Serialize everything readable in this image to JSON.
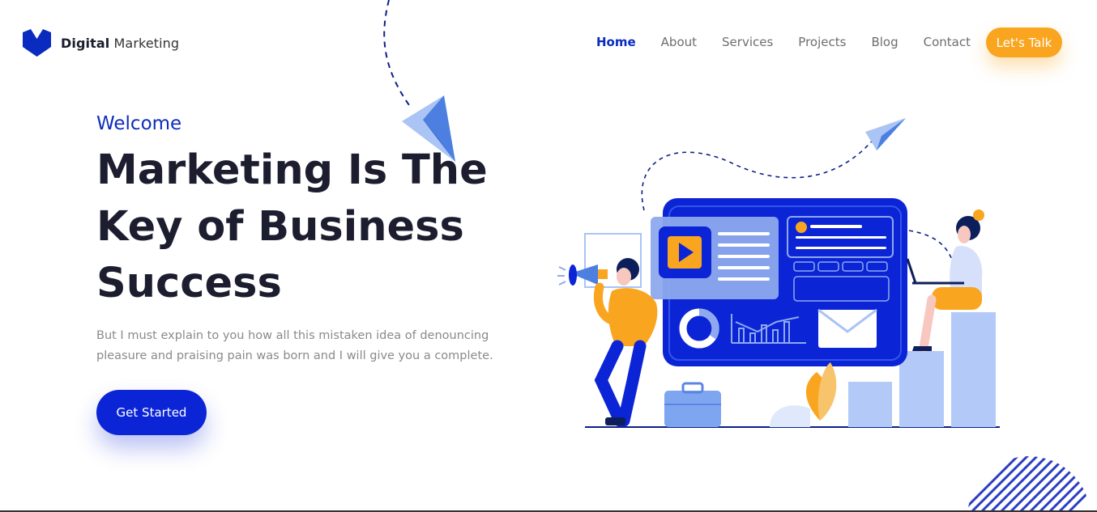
{
  "brand": {
    "name_bold": "Digital",
    "name_light": "Marketing",
    "icon": "logo-mark-icon",
    "color": "#0a2bbf"
  },
  "nav": {
    "items": [
      {
        "label": "Home",
        "active": true
      },
      {
        "label": "About"
      },
      {
        "label": "Services"
      },
      {
        "label": "Projects"
      },
      {
        "label": "Blog"
      },
      {
        "label": "Contact"
      }
    ],
    "cta_label": "Let's Talk"
  },
  "hero": {
    "welcome": "Welcome",
    "headline": "Marketing Is The Key of Business Success",
    "paragraph": "But I must explain to you how all this mistaken idea of denouncing pleasure and praising pain was born and I will give you a complete.",
    "button_label": "Get Started"
  },
  "colors": {
    "primary": "#0b25d6",
    "accent": "#f9a51f",
    "light_blue": "#a9c4f5",
    "dark_text": "#1c1e30"
  }
}
